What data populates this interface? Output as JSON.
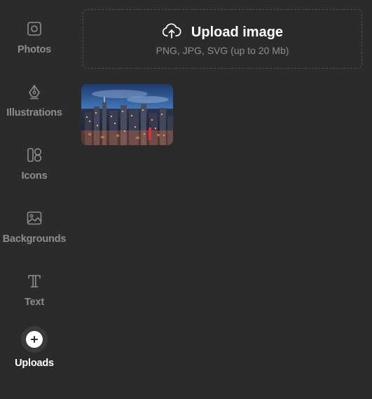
{
  "sidebar": {
    "items": [
      {
        "label": "Photos",
        "icon": "photo-icon"
      },
      {
        "label": "Illustrations",
        "icon": "pen-nib-icon"
      },
      {
        "label": "Icons",
        "icon": "shapes-icon"
      },
      {
        "label": "Backgrounds",
        "icon": "image-icon"
      },
      {
        "label": "Text",
        "icon": "text-t-icon"
      },
      {
        "label": "Uploads",
        "icon": "plus-icon",
        "active": true
      }
    ]
  },
  "upload": {
    "title": "Upload image",
    "subtitle": "PNG, JPG, SVG (up to 20 Mb)",
    "icon": "cloud-upload-icon"
  },
  "uploads": {
    "items": [
      {
        "description_icon": "city-skyline-thumbnail"
      }
    ]
  },
  "colors": {
    "background": "#2b2b2b",
    "label_inactive": "#8e8e8e",
    "label_active": "#ffffff",
    "dropzone_border": "#4e4e4e"
  }
}
